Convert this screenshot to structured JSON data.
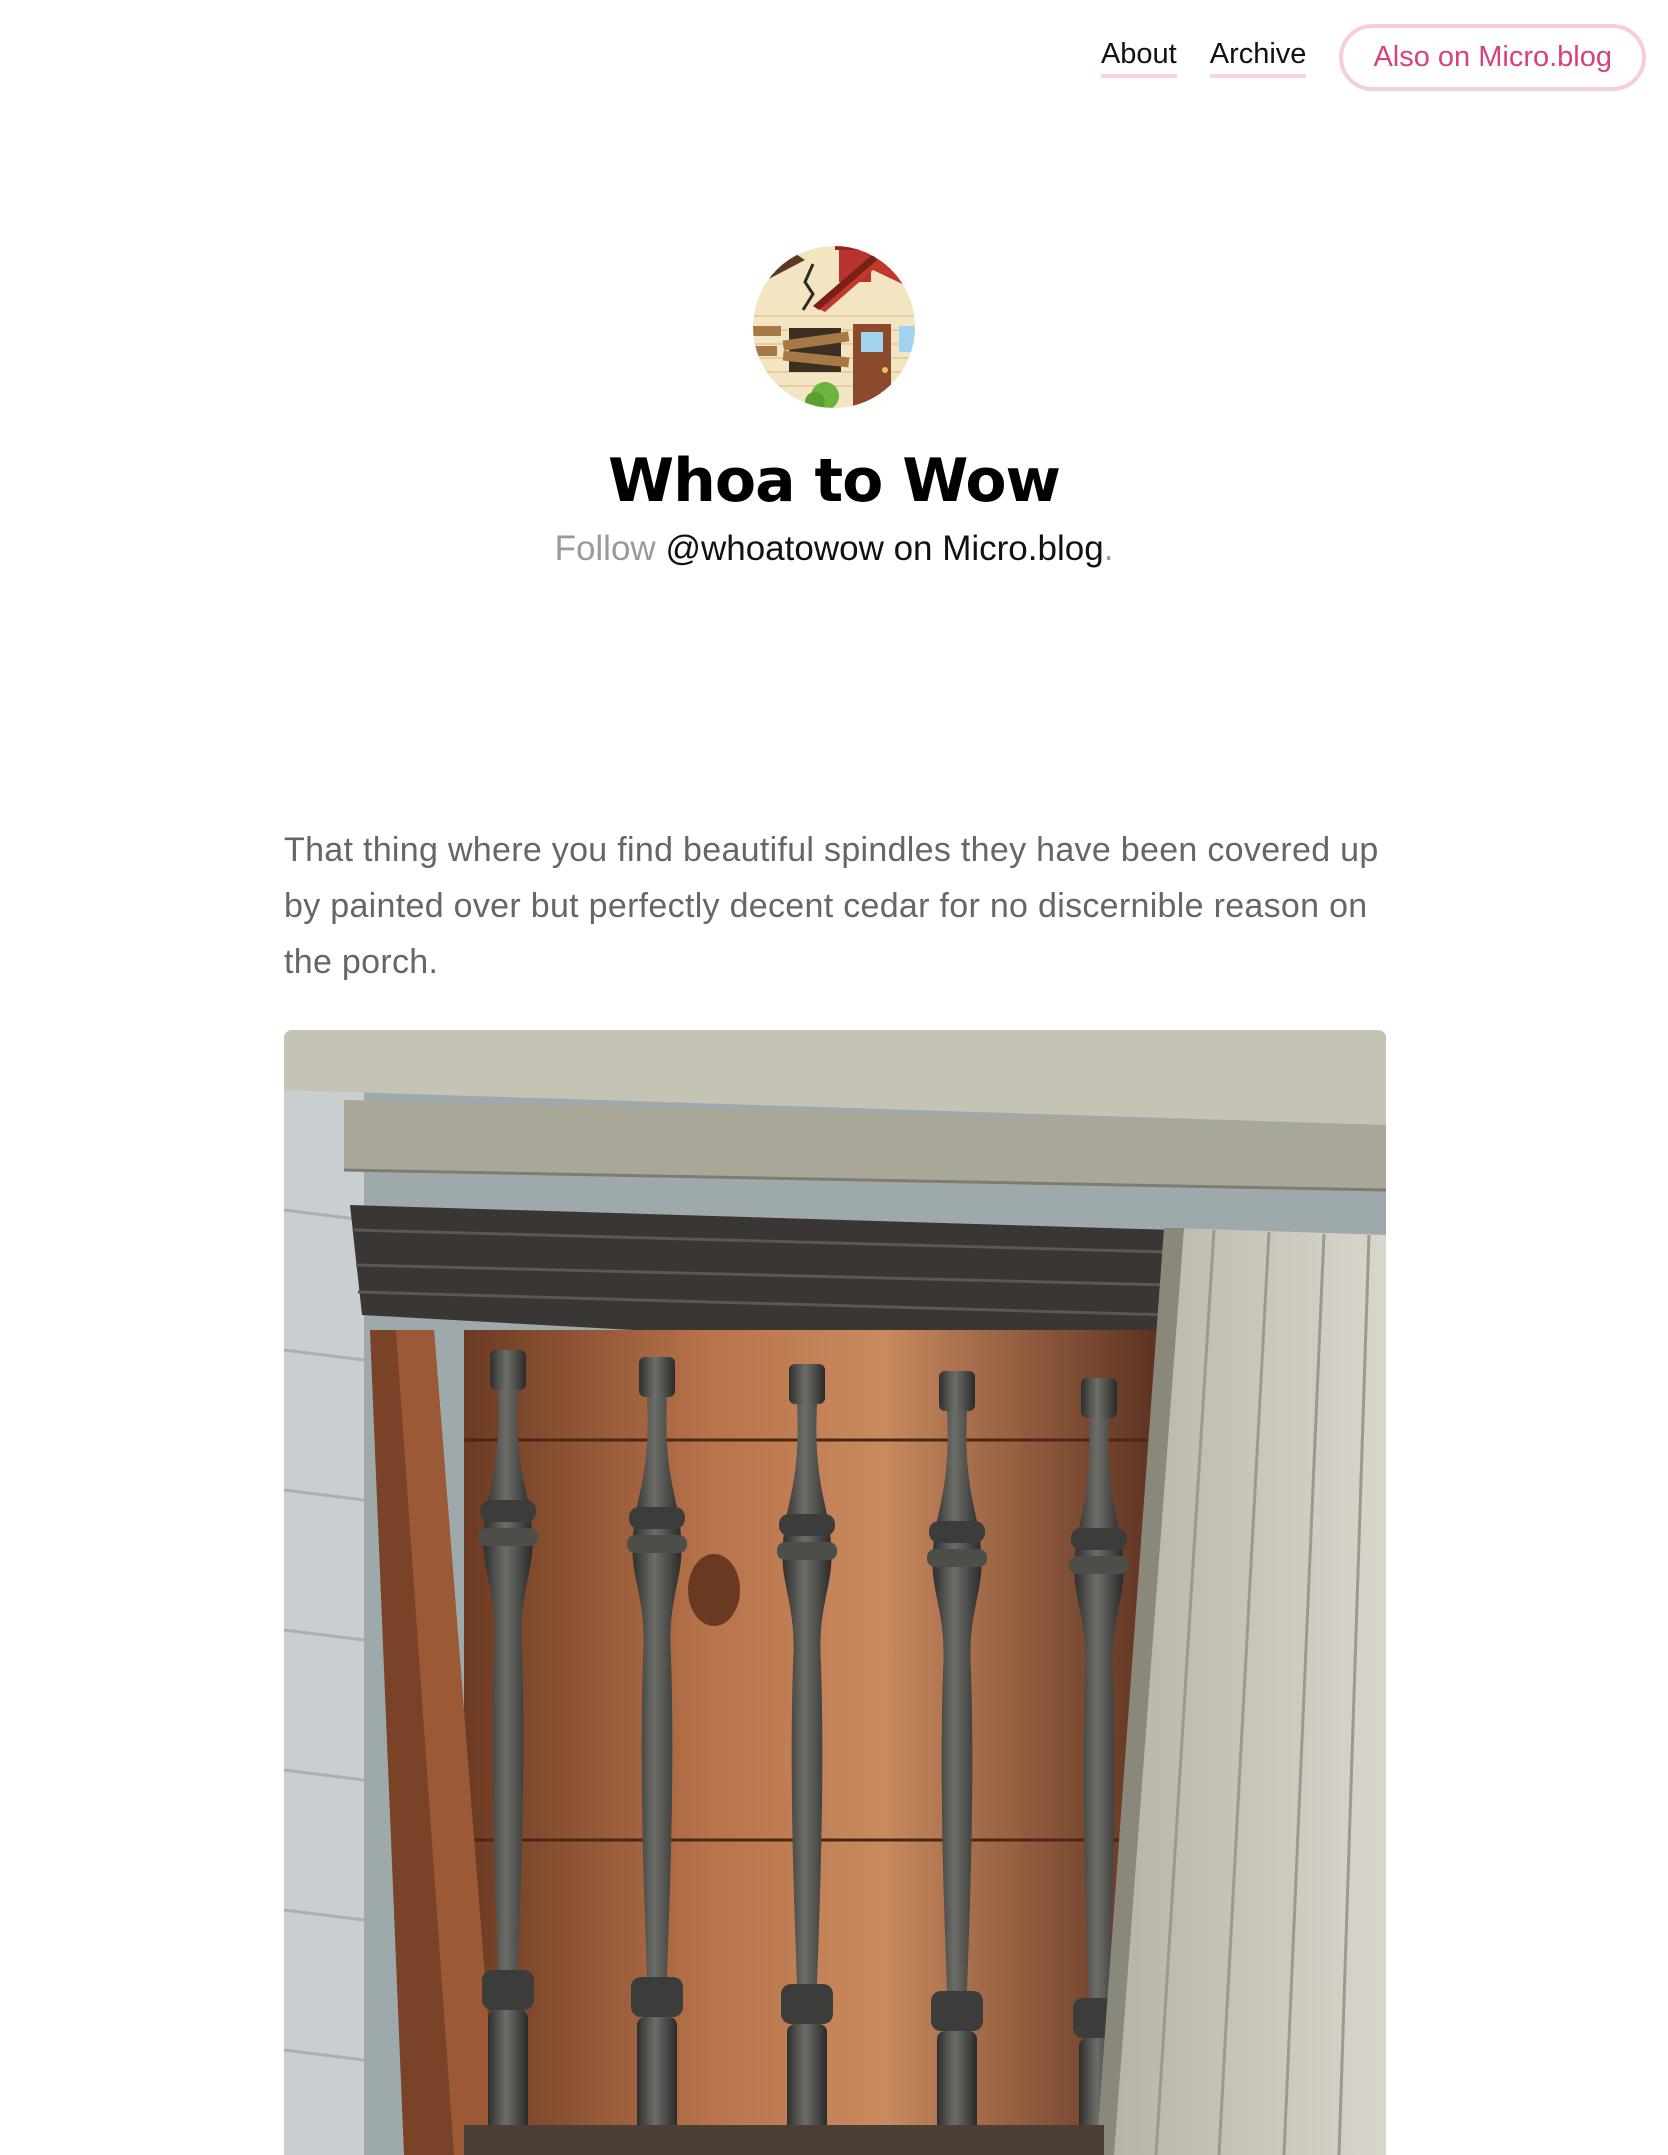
{
  "nav": {
    "about": "About",
    "archive": "Archive",
    "microblog": "Also on Micro.blog"
  },
  "header": {
    "avatar_icon": "derelict-house-icon",
    "title": "Whoa to Wow",
    "follow_prefix": "Follow",
    "follow_link": "@whoatowow on Micro.blog",
    "follow_suffix": "."
  },
  "post": {
    "text": "That thing where you find beautiful spindles they have been covered up by painted over but perfectly decent cedar for no discernible reason on the porch.",
    "photo_subject": "weathered-spindles-porch-photo"
  },
  "colors": {
    "accent": "#d6417f",
    "accent_light": "#f5cddd",
    "muted": "#9a9a9a",
    "body_text": "#666666"
  }
}
